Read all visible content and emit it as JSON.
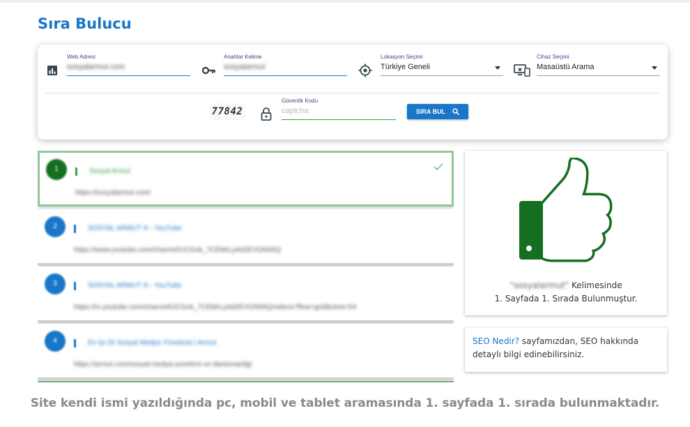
{
  "page_title": "Sıra Bulucu",
  "search_form": {
    "website": {
      "label": "Web Adresi",
      "value": "sosyalarmut.com"
    },
    "keyword": {
      "label": "Anahtar Kelime",
      "value": "sosyalarmut"
    },
    "location": {
      "label": "Lokasyon Seçimi",
      "value": "Türkiye Geneli"
    },
    "device": {
      "label": "Cihaz Seçimi",
      "value": "Masaüstü Arama"
    },
    "captcha_image_text": "77842",
    "security_code": {
      "label": "Güvenlik Kodu",
      "placeholder": "captcha"
    },
    "submit_label": "SIRA BUL"
  },
  "results": [
    {
      "rank": "1",
      "title": "Sosyal Armut",
      "url": "https://sosyalarmut.com/",
      "found": true
    },
    {
      "rank": "2",
      "title": "SOSYAL ARMUT ® - YouTube",
      "url": "https://www.youtube.com/channel/UCGnk_7CEbKLyAd2EVON06Q",
      "found": false
    },
    {
      "rank": "3",
      "title": "SOSYAL ARMUT ® - YouTube",
      "url": "https://m.youtube.com/channel/UCGnk_7CEbKLyAd2EVON06Q/videos?flow=grid&view=54",
      "found": false
    },
    {
      "rank": "4",
      "title": "En İyi 25 Sosyal Medya Yöneticisi | Armut",
      "url": "https://armut.com/sosyal-medya-yonetimi-ve-danismanligi",
      "found": false
    }
  ],
  "result_summary": {
    "keyword": "\"sosyalarmut\"",
    "line1_suffix": " Kelimesinde",
    "line2": "1. Sayfada 1. Sırada Bulunmuştur."
  },
  "seo_info": {
    "link_text": "SEO Nedir?",
    "text": " sayfamızdan, SEO hakkında detaylı bilgi edinebilirsiniz."
  },
  "caption": "Site kendi ismi yazıldığında pc, mobil ve tablet aramasında 1. sayfada 1. sırada bulunmaktadır.",
  "colors": {
    "primary": "#1976c9",
    "success": "#166e21",
    "success_light": "#2e9e3e"
  },
  "icons": {
    "website": "chart-icon",
    "keyword": "key-icon",
    "location": "crosshair-icon",
    "device": "devices-icon",
    "security": "lock-icon",
    "search": "search-icon",
    "found": "check-icon",
    "result": "thumbs-up-icon"
  }
}
